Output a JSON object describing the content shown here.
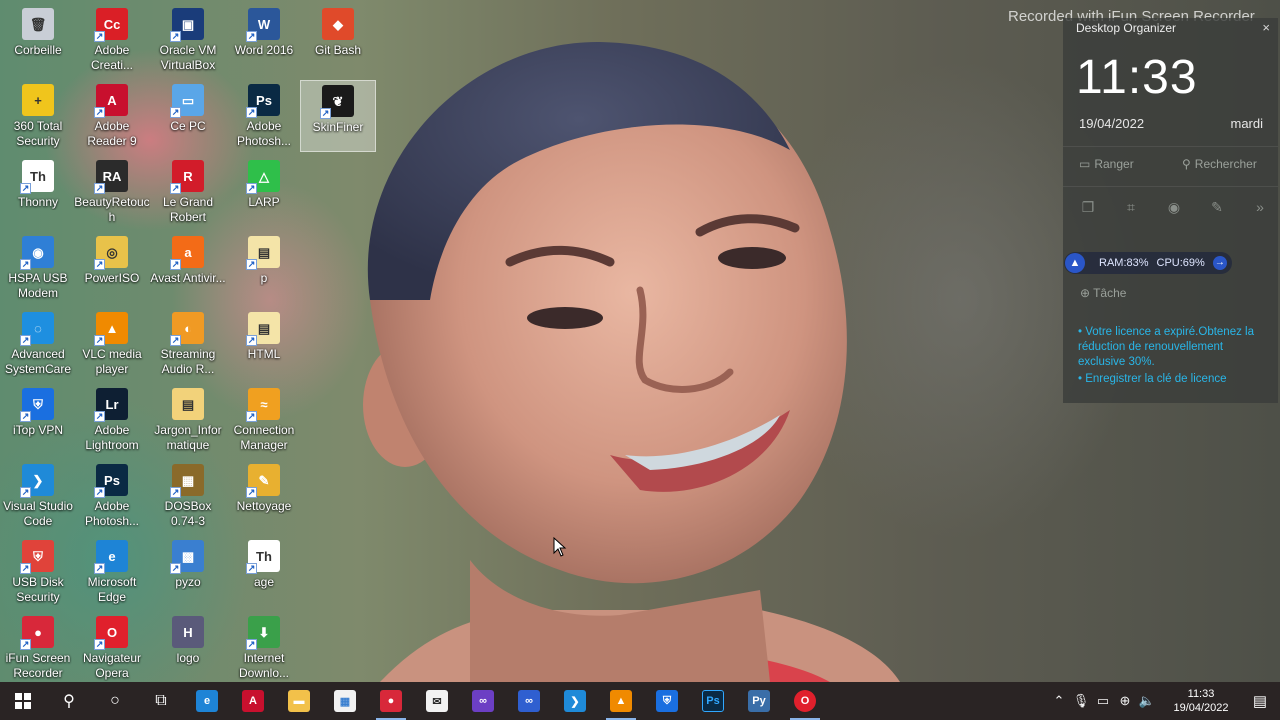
{
  "watermark": "Recorded with iFun Screen Recorder",
  "desktop_icons": [
    {
      "label": "Corbeille",
      "color": "#c9ced6",
      "glyph": "🗑",
      "shortcut": false
    },
    {
      "label": "360 Total Security",
      "color": "#f0c51c",
      "glyph": "+",
      "shortcut": false
    },
    {
      "label": "Thonny",
      "color": "#ffffff",
      "glyph": "Th",
      "shortcut": true
    },
    {
      "label": "HSPA USB Modem",
      "color": "#2f7fd6",
      "glyph": "◉",
      "shortcut": true
    },
    {
      "label": "Advanced SystemCare",
      "color": "#1e8fe0",
      "glyph": "◌",
      "shortcut": true
    },
    {
      "label": "iTop VPN",
      "color": "#1a6fe0",
      "glyph": "⛨",
      "shortcut": true
    },
    {
      "label": "Visual Studio Code",
      "color": "#1f8ad8",
      "glyph": "❯",
      "shortcut": true
    },
    {
      "label": "USB Disk Security",
      "color": "#e0433a",
      "glyph": "⛨",
      "shortcut": true
    },
    {
      "label": "iFun Screen Recorder",
      "color": "#d8283a",
      "glyph": "●",
      "shortcut": true
    },
    {
      "label": "Adobe Creati...",
      "color": "#da1f26",
      "glyph": "Cc",
      "shortcut": true
    },
    {
      "label": "Adobe Reader 9",
      "color": "#c8102e",
      "glyph": "A",
      "shortcut": true
    },
    {
      "label": "BeautyRetouch",
      "color": "#2b2b2b",
      "glyph": "RA",
      "shortcut": true
    },
    {
      "label": "PowerISO",
      "color": "#e8c24a",
      "glyph": "◎",
      "shortcut": true
    },
    {
      "label": "VLC media player",
      "color": "#f08a00",
      "glyph": "▲",
      "shortcut": true
    },
    {
      "label": "Adobe Lightroom",
      "color": "#0e1f33",
      "glyph": "Lr",
      "shortcut": true
    },
    {
      "label": "Adobe Photosh...",
      "color": "#0a2a44",
      "glyph": "Ps",
      "shortcut": true
    },
    {
      "label": "Microsoft Edge",
      "color": "#1e84d6",
      "glyph": "e",
      "shortcut": true
    },
    {
      "label": "Navigateur Opera",
      "color": "#e0202c",
      "glyph": "O",
      "shortcut": true
    },
    {
      "label": "Oracle VM VirtualBox",
      "color": "#1a3c7a",
      "glyph": "▣",
      "shortcut": true
    },
    {
      "label": "Ce PC",
      "color": "#5aa6e8",
      "glyph": "▭",
      "shortcut": true
    },
    {
      "label": "Le Grand Robert",
      "color": "#d21c2a",
      "glyph": "R",
      "shortcut": true
    },
    {
      "label": "Avast Antivir...",
      "color": "#f36b17",
      "glyph": "a",
      "shortcut": true
    },
    {
      "label": "Streaming Audio R...",
      "color": "#f09a24",
      "glyph": "◐",
      "shortcut": true
    },
    {
      "label": "Jargon_Informatique",
      "color": "#f2d27a",
      "glyph": "▤",
      "shortcut": false
    },
    {
      "label": "DOSBox 0.74-3",
      "color": "#8a6a2a",
      "glyph": "▦",
      "shortcut": true
    },
    {
      "label": "pyzo",
      "color": "#3a7fd0",
      "glyph": "▩",
      "shortcut": true
    },
    {
      "label": "logo",
      "color": "#5a5a7a",
      "glyph": "H",
      "shortcut": false
    },
    {
      "label": "Word 2016",
      "color": "#2b579a",
      "glyph": "W",
      "shortcut": true
    },
    {
      "label": "Adobe Photosh...",
      "color": "#0a2a44",
      "glyph": "Ps",
      "shortcut": true
    },
    {
      "label": "LARP",
      "color": "#2fbf4a",
      "glyph": "△",
      "shortcut": true
    },
    {
      "label": "p",
      "color": "#f4e4a8",
      "glyph": "▤",
      "shortcut": true
    },
    {
      "label": "HTML",
      "color": "#f4e4a8",
      "glyph": "▤",
      "shortcut": true
    },
    {
      "label": "Connection Manager",
      "color": "#f0a020",
      "glyph": "≈",
      "shortcut": true
    },
    {
      "label": "Nettoyage",
      "color": "#e8b030",
      "glyph": "✎",
      "shortcut": true
    },
    {
      "label": "age",
      "color": "#ffffff",
      "glyph": "Th",
      "shortcut": true
    },
    {
      "label": "Internet Downlo...",
      "color": "#3aa04a",
      "glyph": "⬇",
      "shortcut": true
    },
    {
      "label": "Git Bash",
      "color": "#e04a2a",
      "glyph": "◆",
      "shortcut": false
    },
    {
      "label": "SkinFiner",
      "color": "#1a1a1a",
      "glyph": "❦",
      "shortcut": true
    }
  ],
  "organizer": {
    "title": "Desktop Organizer",
    "close_label": "×",
    "clock": "11:33",
    "date": "19/04/2022",
    "day": "mardi",
    "arrange_label": "Ranger",
    "search_label": "Rechercher",
    "stats_ram": "RAM:83%",
    "stats_cpu": "CPU:69%",
    "task_label": "Tâche",
    "license_line1": "• Votre licence a expiré.Obtenez la réduction de renouvellement exclusive 30%.",
    "license_line2": "• Enregistrer la clé de licence"
  },
  "taskbar": {
    "clock_time": "11:33",
    "clock_date": "19/04/2022"
  }
}
